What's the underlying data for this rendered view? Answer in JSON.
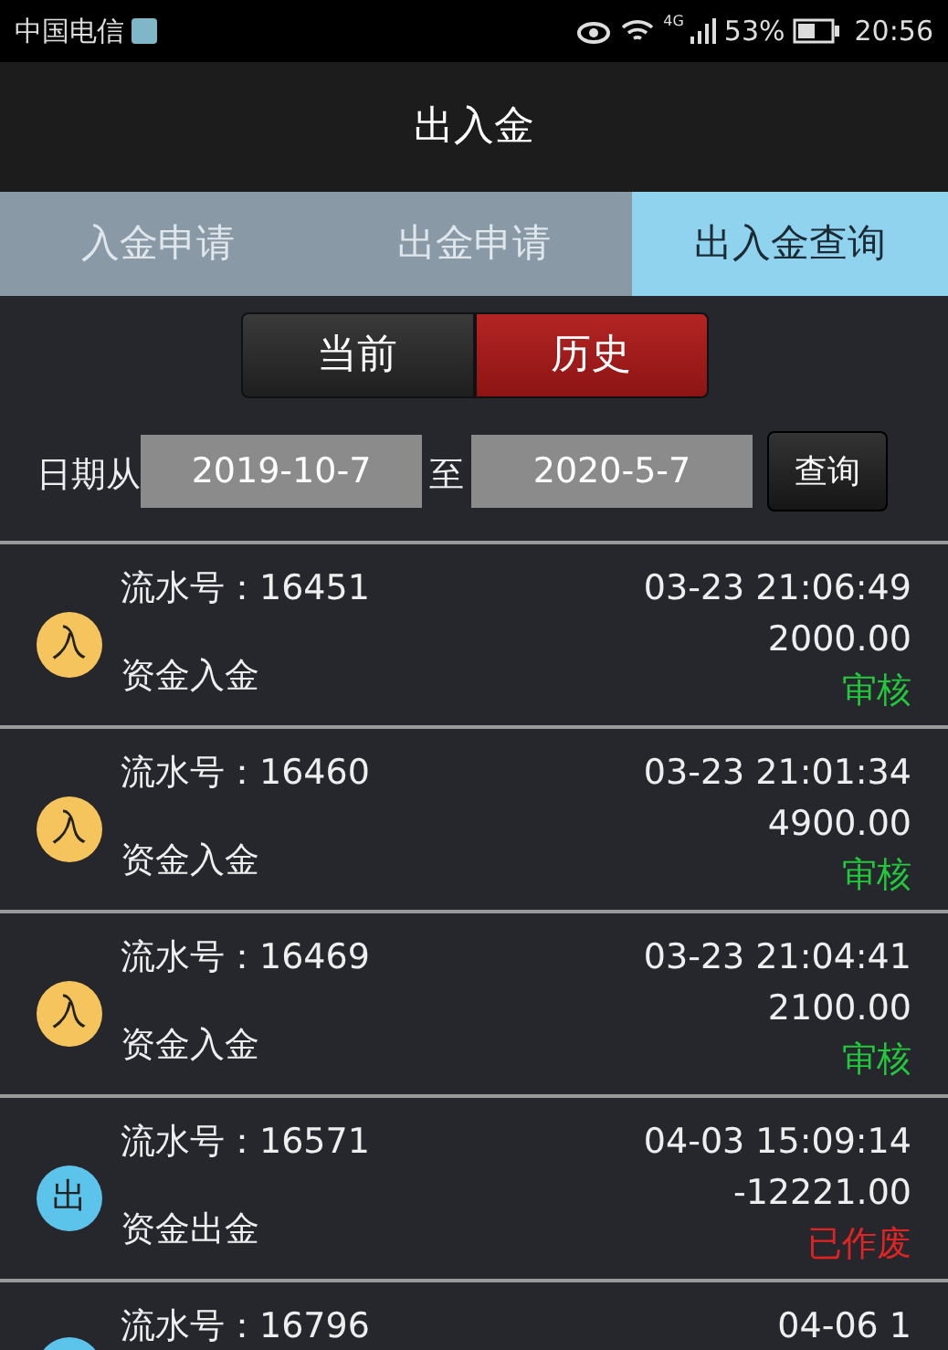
{
  "status_bar": {
    "carrier": "中国电信",
    "network": "4G",
    "battery": "53%",
    "time": "20:56"
  },
  "window": {
    "title": "出入金"
  },
  "tabs": [
    {
      "label": "入金申请",
      "selected": false
    },
    {
      "label": "出金申请",
      "selected": false
    },
    {
      "label": "出入金查询",
      "selected": true
    }
  ],
  "segments": [
    {
      "label": "当前",
      "selected": false
    },
    {
      "label": "历史",
      "selected": true
    }
  ],
  "date_filter": {
    "from_label": "日期从",
    "from": "2019-10-7",
    "to_label": "至",
    "to": "2020-5-7",
    "button": "查询"
  },
  "records": [
    {
      "kind": "deposit",
      "icon": "入",
      "serial": "流水号：16451",
      "time": "03-23 21:06:49",
      "amount": "2000.00",
      "type": "资金入金",
      "status": {
        "text": "审核",
        "color": "#22c93c"
      }
    },
    {
      "kind": "deposit",
      "icon": "入",
      "serial": "流水号：16460",
      "time": "03-23 21:01:34",
      "amount": "4900.00",
      "type": "资金入金",
      "status": {
        "text": "审核",
        "color": "#22c93c"
      }
    },
    {
      "kind": "deposit",
      "icon": "入",
      "serial": "流水号：16469",
      "time": "03-23 21:04:41",
      "amount": "2100.00",
      "type": "资金入金",
      "status": {
        "text": "审核",
        "color": "#22c93c"
      }
    },
    {
      "kind": "withdraw",
      "icon": "出",
      "serial": "流水号：16571",
      "time": "04-03 15:09:14",
      "amount": "-12221.00",
      "type": "资金出金",
      "status": {
        "text": "已作废",
        "color": "#e02424"
      }
    },
    {
      "kind": "withdraw",
      "serial": "流水号：16796",
      "time": "04-06 1"
    }
  ]
}
